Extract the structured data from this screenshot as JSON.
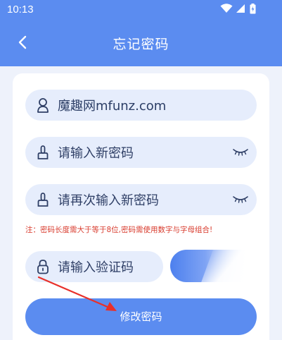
{
  "status_bar": {
    "time": "10:13",
    "icons": [
      "wifi-icon",
      "signal-icon",
      "battery-icon"
    ]
  },
  "nav": {
    "back_icon": "chevron-left-icon",
    "title": "忘记密码"
  },
  "form": {
    "account_value": "魔趣网mfunz.com",
    "new_password_placeholder": "请输入新密码",
    "confirm_password_placeholder": "请再次输入新密码",
    "notice": "注：密码长度需大于等于8位,密码需使用数字与字母组合!",
    "code_placeholder": "请输入验证码",
    "submit_label": "修改密码"
  },
  "colors": {
    "header": "#5b8cf0",
    "field_bg": "#e6edfc",
    "notice": "#d83a2c",
    "annotation_arrow": "#e8302a"
  }
}
